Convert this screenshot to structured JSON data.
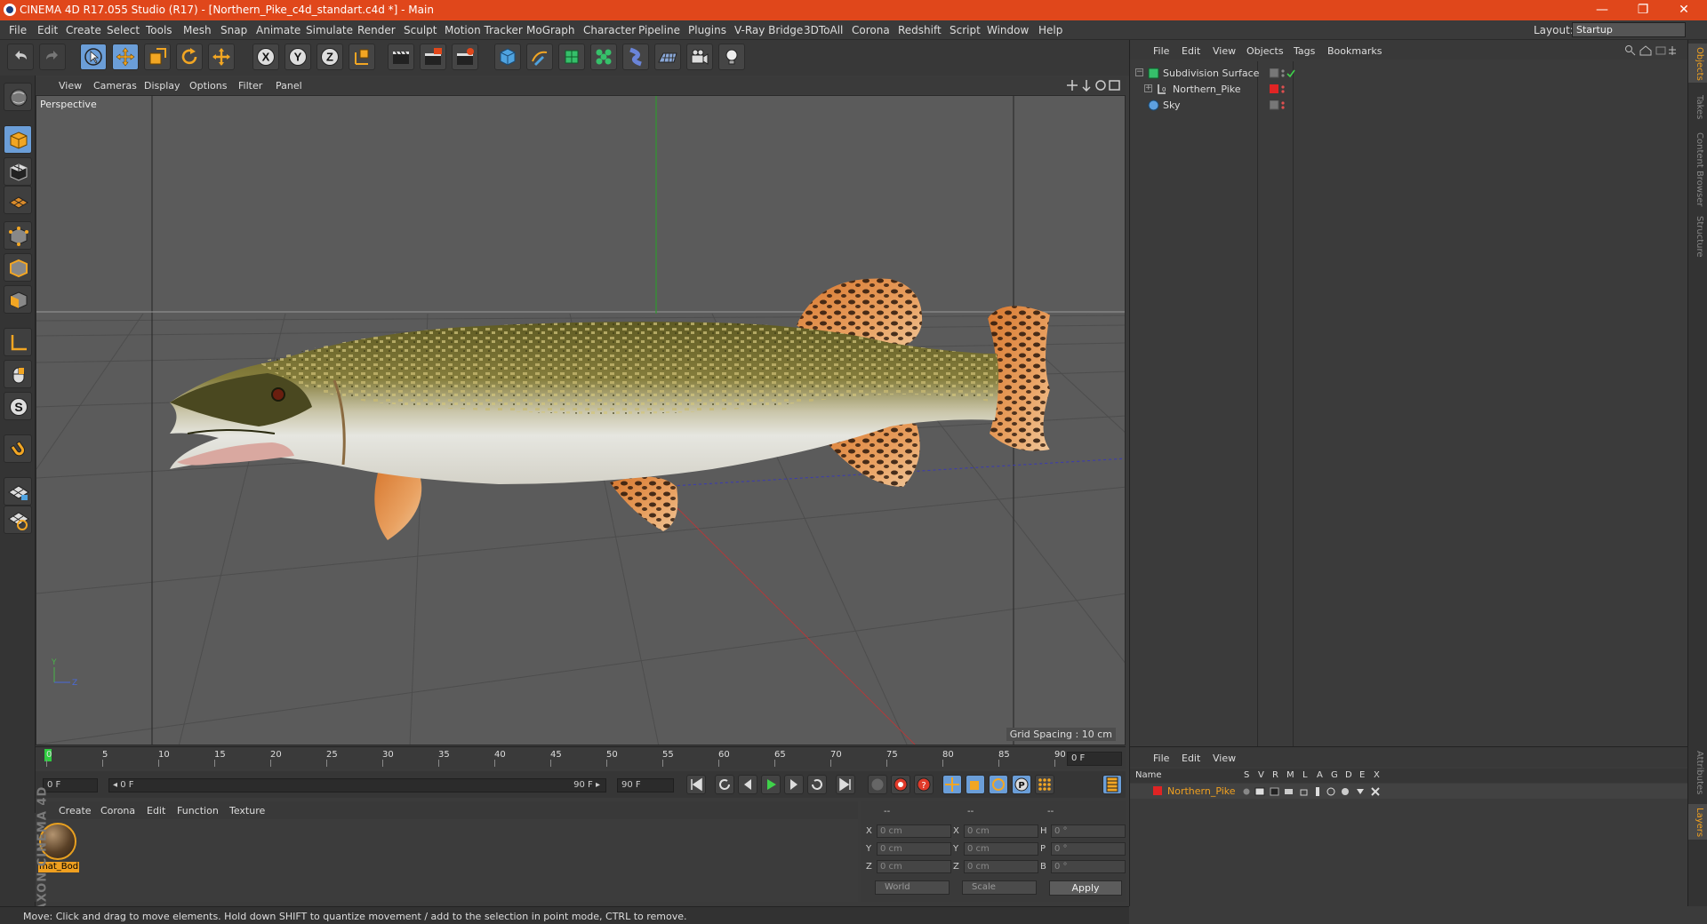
{
  "title": "CINEMA 4D R17.055 Studio (R17) - [Northern_Pike_c4d_standart.c4d *] - Main",
  "window_controls": {
    "minimize": "—",
    "restore": "❐",
    "close": "✕"
  },
  "menu": [
    "File",
    "Edit",
    "Create",
    "Select",
    "Tools",
    "Mesh",
    "Snap",
    "Animate",
    "Simulate",
    "Render",
    "Sculpt",
    "Motion Tracker",
    "MoGraph",
    "Character",
    "Pipeline",
    "Plugins",
    "V-Ray Bridge",
    "3DToAll",
    "Corona",
    "Redshift",
    "Script",
    "Window",
    "Help"
  ],
  "layout": {
    "label": "Layout:",
    "value": "Startup"
  },
  "toolbar_icons": [
    "undo-icon",
    "redo-icon",
    "live-selection-icon",
    "move-icon",
    "scale-icon",
    "rotate-icon",
    "recent-tool-icon",
    "x-axis-icon",
    "y-axis-icon",
    "z-axis-icon",
    "world-coordinates-icon",
    "render-view-icon",
    "render-picture-viewer-icon",
    "render-settings-icon",
    "cube-icon",
    "pen-icon",
    "subdivision-icon",
    "cloner-icon",
    "deformer-icon",
    "floor-icon",
    "camera-icon",
    "light-icon"
  ],
  "left_tools": [
    "model-mode-icon",
    "texture-mode-icon",
    "workplane-icon",
    "points-mode-icon",
    "edges-mode-icon",
    "polygons-mode-icon",
    "axis-icon",
    "tweak-icon",
    "snap-icon",
    "magnet-icon",
    "lock-workplane-icon",
    "planar-workplane-icon"
  ],
  "viewport": {
    "menu": [
      "View",
      "Cameras",
      "Display",
      "Options",
      "Filter",
      "Panel"
    ],
    "label": "Perspective",
    "grid_spacing": "Grid Spacing : 10 cm",
    "nav_icons": [
      "move-view-icon",
      "zoom-view-icon",
      "rotate-view-icon",
      "maximize-view-icon"
    ]
  },
  "timeline": {
    "ticks": [
      "0",
      "5",
      "10",
      "15",
      "20",
      "25",
      "30",
      "35",
      "40",
      "45",
      "50",
      "55",
      "60",
      "65",
      "70",
      "75",
      "80",
      "85",
      "90"
    ],
    "current_frame": "0 F"
  },
  "transport": {
    "start": "0 F",
    "range_left": "◂ 0 F",
    "range_right": "90 F ▸",
    "end": "90 F"
  },
  "materials": {
    "menu": [
      "Create",
      "Corona",
      "Edit",
      "Function",
      "Texture"
    ],
    "items": [
      {
        "name": "mat_Bod"
      }
    ]
  },
  "coords": {
    "headers": [
      "--",
      "--",
      "--"
    ],
    "rows": [
      {
        "a": "X",
        "av": "0 cm",
        "b": "X",
        "bv": "0 cm",
        "c": "H",
        "cv": "0 °"
      },
      {
        "a": "Y",
        "av": "0 cm",
        "b": "Y",
        "bv": "0 cm",
        "c": "P",
        "cv": "0 °"
      },
      {
        "a": "Z",
        "av": "0 cm",
        "b": "Z",
        "bv": "0 cm",
        "c": "B",
        "cv": "0 °"
      }
    ],
    "mode": "World",
    "scale": "Scale",
    "apply": "Apply"
  },
  "brand": "MAXON CINEMA 4D",
  "status": "Move: Click and drag to move elements. Hold down SHIFT to quantize movement / add to the selection in point mode, CTRL to remove.",
  "objects": {
    "menu": [
      "File",
      "Edit",
      "View",
      "Objects",
      "Tags",
      "Bookmarks"
    ],
    "items": [
      {
        "name": "Subdivision Surface",
        "indent": 0
      },
      {
        "name": "Northern_Pike",
        "indent": 1
      },
      {
        "name": "Sky",
        "indent": 0
      }
    ]
  },
  "layers": {
    "menu": [
      "File",
      "Edit",
      "View"
    ],
    "headers": [
      "Name",
      "S",
      "V",
      "R",
      "M",
      "L",
      "A",
      "G",
      "D",
      "E",
      "X"
    ],
    "row": {
      "name": "Northern_Pike",
      "color": "#e02424"
    }
  },
  "right_tabs": [
    "Objects",
    "Takes",
    "Content Browser",
    "Structure",
    "Attributes",
    "Layers"
  ],
  "colors": {
    "accent": "#e0471b",
    "selection": "#f0a020",
    "active_tool": "#6b9ed8"
  }
}
